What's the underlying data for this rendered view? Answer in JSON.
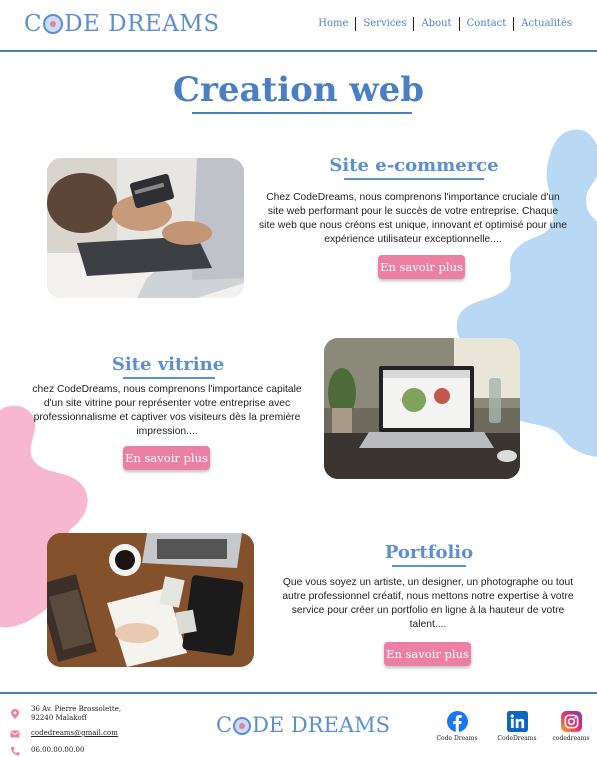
{
  "header": {
    "logo": {
      "before": "C",
      "after": "DE DREAMS"
    },
    "nav": [
      "Home",
      "Services",
      "About",
      "Contact",
      "Actualités"
    ]
  },
  "page_title": "Creation web",
  "sections": [
    {
      "title": "Site e-commerce",
      "text": "Chez CodeDreams, nous comprenons l'importance cruciale d'un site web performant pour le succès de votre entreprise. Chaque site web que nous créons est unique, innovant et optimisé pour une expérience utilisateur exceptionnelle....",
      "button": "En savoir plus",
      "image": "laptop-credit-card-photo"
    },
    {
      "title": "Site vitrine",
      "text": "chez CodeDreams, nous comprenons l'importance capitale d'un site vitrine pour représenter votre entreprise avec professionnalisme et captiver vos visiteurs dès la première impression....",
      "button": "En savoir plus",
      "image": "laptop-desk-photo"
    },
    {
      "title": "Portfolio",
      "text": "Que vous soyez un artiste, un designer, un photographe ou tout autre professionnel créatif, nous mettons notre expertise à votre service pour créer un portfolio en ligne à la hauteur de votre talent....",
      "button": "En savoir plus",
      "image": "desk-notebook-photo"
    }
  ],
  "footer": {
    "address_line1": "36 Av. Pierre Brossolette,",
    "address_line2": "92240 Malakoff",
    "email": "codedreams@gmail.com",
    "phone": "06.00.00.00.00",
    "logo": {
      "before": "C",
      "after": "DE DREAMS"
    },
    "social": [
      {
        "icon": "facebook-icon",
        "label": "Code Dreams"
      },
      {
        "icon": "linkedin-icon",
        "label": "CodeDreams"
      },
      {
        "icon": "instagram-icon",
        "label": "codedreams"
      }
    ]
  },
  "colors": {
    "accent_blue": "#4a7fc1",
    "button_pink": "#ec7fa4",
    "blob_blue": "#b9d8f3",
    "blob_pink": "#f7b8cf"
  }
}
